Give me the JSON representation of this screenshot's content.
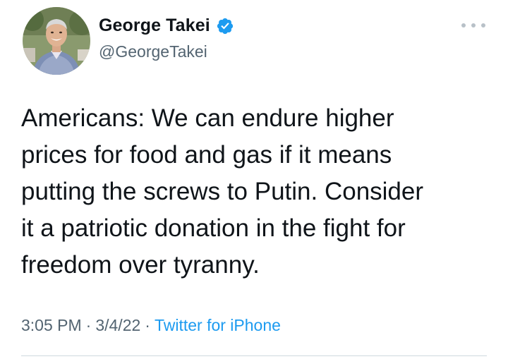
{
  "author": {
    "display_name": "George Takei",
    "handle": "@GeorgeTakei",
    "verified": true,
    "avatar_icon": "profile-photo",
    "verified_icon": "verified-badge-icon"
  },
  "tweet": {
    "text": "Americans: We can endure higher\nprices for food and gas if it means\nputting the screws to Putin. Consider\nit a patriotic donation in the fight for\nfreedom over tyranny.",
    "time": "3:05 PM",
    "separator": "·",
    "date": "3/4/22",
    "source": "Twitter for iPhone"
  },
  "menu": {
    "icon": "more-options-icon"
  },
  "colors": {
    "text": "#0f1419",
    "secondary": "#536471",
    "accent": "#1d9bf0",
    "divider": "#cfd9de"
  }
}
